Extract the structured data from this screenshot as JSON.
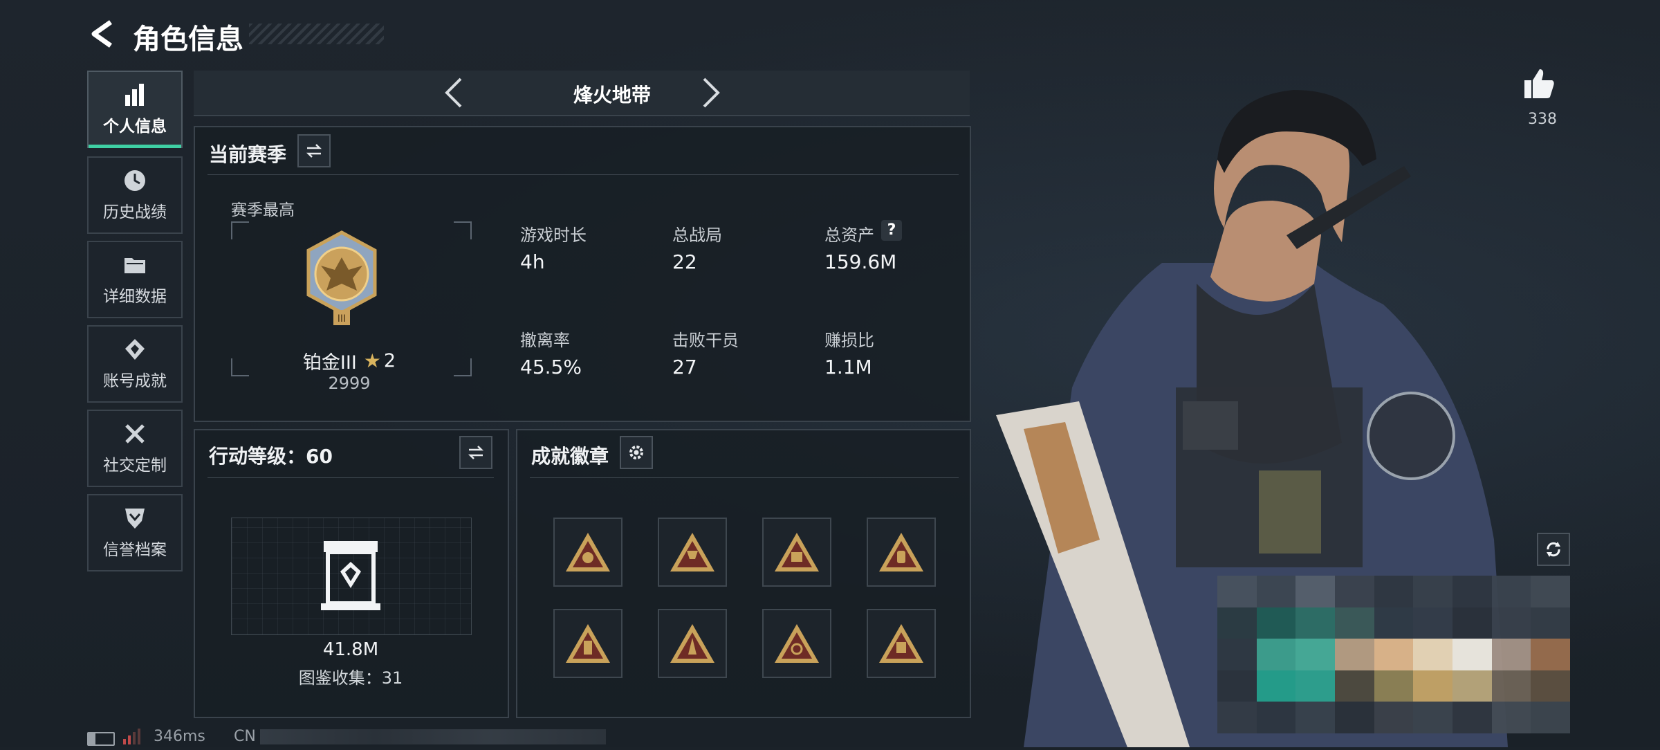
{
  "header": {
    "title": "角色信息"
  },
  "mode_selector": {
    "label": "烽火地带"
  },
  "nav": {
    "items": [
      {
        "label": "个人信息",
        "icon": "bar-chart-icon",
        "active": true
      },
      {
        "label": "历史战绩",
        "icon": "clock-icon",
        "active": false
      },
      {
        "label": "详细数据",
        "icon": "folder-icon",
        "active": false
      },
      {
        "label": "账号成就",
        "icon": "achievement-icon",
        "active": false
      },
      {
        "label": "社交定制",
        "icon": "tools-icon",
        "active": false
      },
      {
        "label": "信誉档案",
        "icon": "shield-icon",
        "active": false
      }
    ]
  },
  "season": {
    "title": "当前赛季",
    "best_label": "赛季最高",
    "rank_name": "铂金III",
    "rank_stars": "2",
    "rank_score": "2999",
    "stats": [
      {
        "label": "游戏时长",
        "value": "4h"
      },
      {
        "label": "总战局",
        "value": "22"
      },
      {
        "label": "总资产",
        "value": "159.6M",
        "help": "?"
      },
      {
        "label": "撤离率",
        "value": "45.5%"
      },
      {
        "label": "击败干员",
        "value": "27"
      },
      {
        "label": "赚损比",
        "value": "1.1M"
      }
    ]
  },
  "action_level": {
    "title": "行动等级：60",
    "value": "41.8M",
    "collection": "图鉴收集：31"
  },
  "achievements": {
    "title": "成就徽章",
    "badges": [
      "badge-1",
      "badge-2",
      "badge-3",
      "badge-4",
      "badge-5",
      "badge-6",
      "badge-7",
      "badge-8"
    ]
  },
  "likes": {
    "count": "338"
  },
  "status_bar": {
    "ping": "346ms",
    "region": "CN"
  },
  "colors": {
    "accent": "#3fd0a4",
    "gold": "#c9a25a",
    "panel_border": "#3a434c"
  }
}
